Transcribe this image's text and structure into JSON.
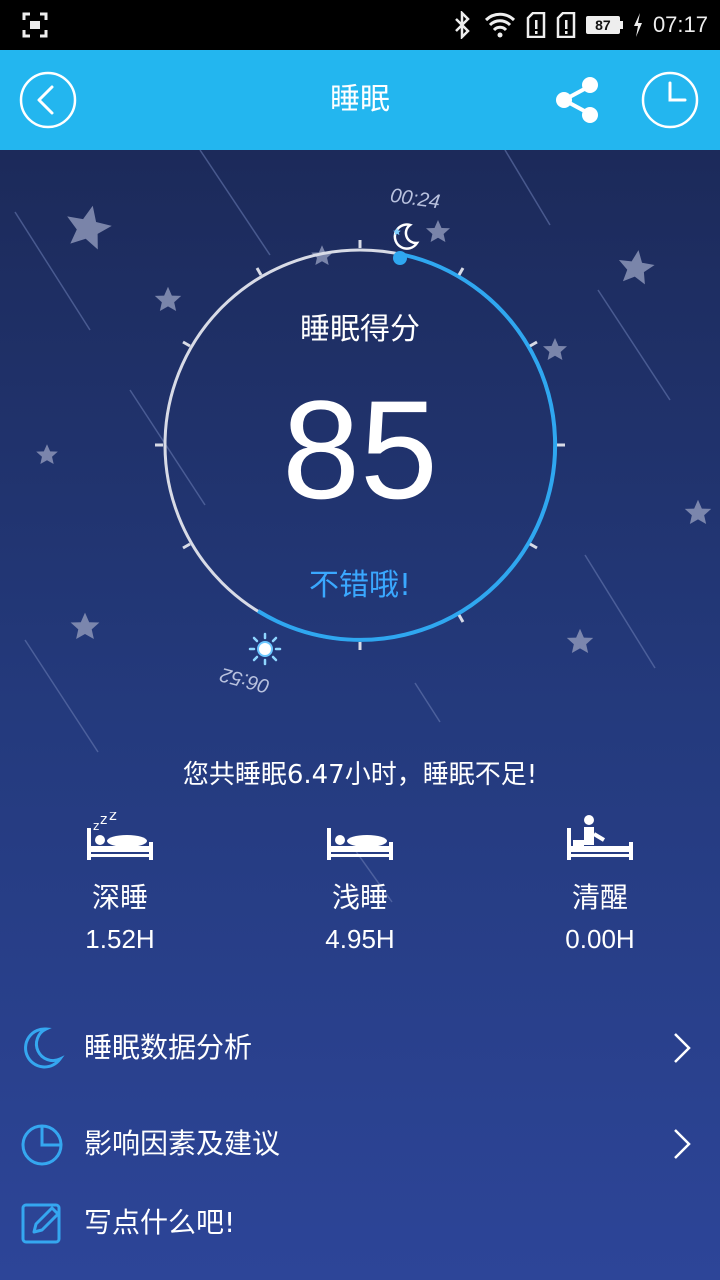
{
  "status_bar": {
    "time": "07:17",
    "battery_level": "87"
  },
  "header": {
    "title": "睡眠",
    "icons": [
      "back-icon",
      "share-icon",
      "clock-icon"
    ]
  },
  "sleep": {
    "start_time": "00:24",
    "end_time": "06:52",
    "score_label": "睡眠得分",
    "score": "85",
    "score_comment": "不错哦!",
    "summary": "您共睡眠6.47小时，睡眠不足!",
    "stages": [
      {
        "name": "深睡",
        "value": "1.52H",
        "icon": "deep-sleep-icon"
      },
      {
        "name": "浅睡",
        "value": "4.95H",
        "icon": "light-sleep-icon"
      },
      {
        "name": "清醒",
        "value": "0.00H",
        "icon": "awake-icon"
      }
    ]
  },
  "menu": [
    {
      "label": "睡眠数据分析",
      "icon": "moon-icon"
    },
    {
      "label": "影响因素及建议",
      "icon": "pie-chart-icon"
    },
    {
      "label": "写点什么吧!",
      "icon": "edit-icon"
    }
  ],
  "colors": {
    "header_bg": "#23b6ef",
    "accent_blue": "#3aa8ff",
    "background_top": "#1c2a5a",
    "background_bottom": "#2d4598"
  }
}
